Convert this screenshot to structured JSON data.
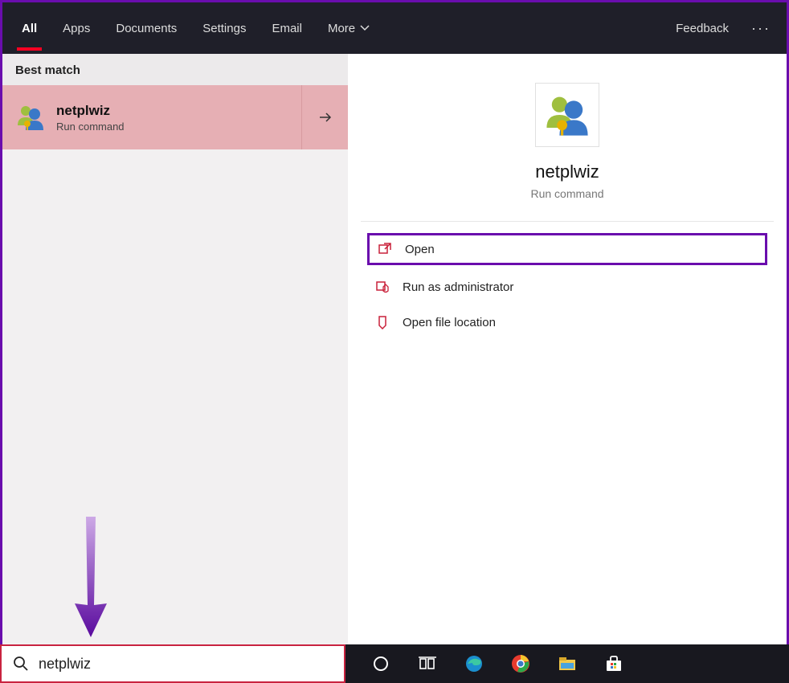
{
  "tabs": {
    "all": "All",
    "apps": "Apps",
    "documents": "Documents",
    "settings": "Settings",
    "email": "Email",
    "more": "More"
  },
  "header": {
    "feedback": "Feedback"
  },
  "sections": {
    "best_match": "Best match"
  },
  "result": {
    "title": "netplwiz",
    "subtitle": "Run command"
  },
  "detail": {
    "title": "netplwiz",
    "subtitle": "Run command"
  },
  "actions": {
    "open": "Open",
    "run_admin": "Run as administrator",
    "open_loc": "Open file location"
  },
  "search": {
    "value": "netplwiz"
  }
}
